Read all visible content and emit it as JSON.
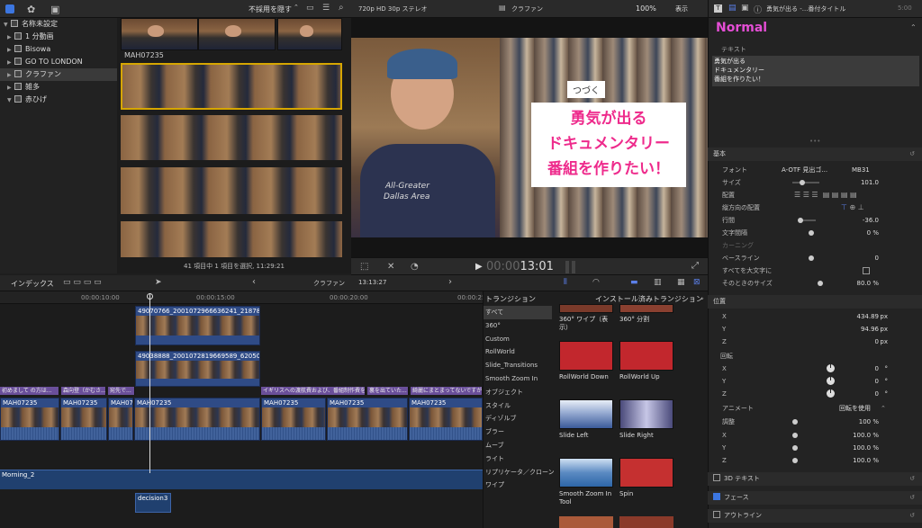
{
  "libraries": {
    "header": "名称未設定",
    "items": [
      "1 分動画",
      "Bisowa",
      "GO TO LONDON",
      "クラファン",
      "雑多",
      "赤ひげ"
    ]
  },
  "browser": {
    "filter_label": "不採用を隠す",
    "clip_label": "MAH07235",
    "status": "41 項目中 1 項目を選択, 11:29:21"
  },
  "viewer": {
    "format": "720p HD 30p ステレオ",
    "project": "クラファン",
    "zoom": "100%",
    "view": "表示",
    "timecode": "00:00:13:01",
    "timecode_dim": "00:00",
    "timecode_bright": "13:01",
    "title_lines": [
      "勇気が出る",
      "ドキュメンタリー",
      "番組を作りたい！"
    ],
    "collage_text": "つづく"
  },
  "timeline": {
    "index_label": "インデックス",
    "project": "クラファン",
    "duration": "13:13:27",
    "ruler": [
      "00:00:10:00",
      "00:00:15:00",
      "00:00:20:00",
      "00:00:25"
    ],
    "connected_clips": [
      "49070766_2001072966636241_218785467...",
      "49038888_2001072819669589_620505128..."
    ],
    "captions": [
      "初めまして の方は...",
      "森向登（かむさ...",
      "宛先で...",
      "イギリスへの渡航費および、番組制作費を...",
      "裏を出ていた...",
      "綺麗にまとまってないですが・..."
    ],
    "main_clip": "MAH07235",
    "audio_clip": "Morning_2",
    "bottom_clip": "decision3"
  },
  "transitions": {
    "header": "トランジション",
    "installed_label": "インストール済みトランジション",
    "categories": [
      "すべて",
      "360°",
      "Custom",
      "RollWorld",
      "Slide_Transitions",
      "Smooth Zoom In",
      "オブジェクト",
      "スタイル",
      "ディゾルブ",
      "ブラー",
      "ムーブ",
      "ライト",
      "リプリケータ／クローン",
      "ワイプ"
    ],
    "items": [
      {
        "name": "360° ワイプ（表示）",
        "color": "#7a3a2a"
      },
      {
        "name": "360° 分割",
        "color": "#8a4030"
      },
      {
        "name": "RollWorld Down",
        "color": "#c2272d"
      },
      {
        "name": "RollWorld Up",
        "color": "#c2272d"
      },
      {
        "name": "Slide Left",
        "color": "#3a5a9a"
      },
      {
        "name": "Slide Right",
        "color": "#4a4a7a"
      },
      {
        "name": "Smooth Zoom In Tool",
        "color": "#2d66a8"
      },
      {
        "name": "Spin",
        "color": "#c53030"
      }
    ]
  },
  "inspector": {
    "title_bar": "勇気が出る -...番付タイトル",
    "title_time": "5:00",
    "style": "Normal",
    "text_label": "テキスト",
    "text_lines": [
      "勇気が出る",
      "ドキュメンタリー",
      "番組を作りたい！"
    ],
    "basic": "基本",
    "rows": [
      {
        "k": "フォント",
        "v": "A-OTF 見出ゴ...",
        "v2": "MB31"
      },
      {
        "k": "サイズ",
        "v": "101.0",
        "slider": 0.3
      },
      {
        "k": "配置",
        "v": ""
      },
      {
        "k": "縦方向の配置",
        "v": ""
      },
      {
        "k": "行間",
        "v": "-36.0",
        "slider": 0.1
      },
      {
        "k": "文字間隔",
        "v": "0 %",
        "slider": 0.5
      },
      {
        "k": "カーニング",
        "v": ""
      },
      {
        "k": "ベースライン",
        "v": "0",
        "slider": 0.5
      },
      {
        "k": "すべてを大文字に",
        "v": ""
      },
      {
        "k": "そのときのサイズ",
        "v": "80.0 %",
        "slider": 0.7
      }
    ],
    "position_label": "位置",
    "position": [
      {
        "k": "X",
        "v": "434.89",
        "u": "px"
      },
      {
        "k": "Y",
        "v": "94.96",
        "u": "px"
      },
      {
        "k": "Z",
        "v": "0",
        "u": "px"
      }
    ],
    "rotation_label": "回転",
    "rotation": [
      {
        "k": "X",
        "v": "0",
        "u": "°"
      },
      {
        "k": "Y",
        "v": "0",
        "u": "°"
      },
      {
        "k": "Z",
        "v": "0",
        "u": "°"
      }
    ],
    "animate_label": "アニメート",
    "animate_value": "回転を使用",
    "scale_label": "調整",
    "scale_all": "100 %",
    "scale": [
      {
        "k": "X",
        "v": "100.0 %"
      },
      {
        "k": "Y",
        "v": "100.0 %"
      },
      {
        "k": "Z",
        "v": "100.0 %"
      }
    ],
    "sections": [
      "3D テキスト",
      "フェース",
      "アウトライン"
    ]
  }
}
